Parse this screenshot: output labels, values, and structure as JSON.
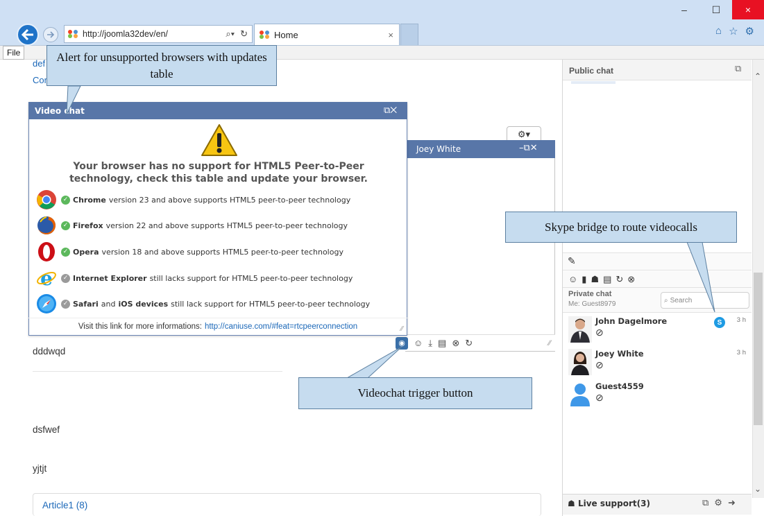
{
  "browser": {
    "url": "http://joomla32dev/en/",
    "tab_title": "Home",
    "menu_file": "File",
    "tab_close": "×",
    "win_min": "–",
    "win_max": "☐",
    "win_close": "×"
  },
  "page": {
    "link_top": "def",
    "link_contact": "Contact",
    "text_1": "dddwqd",
    "text_2": "dsfwef",
    "text_3": "yjtjt",
    "article_link": "Article1 (8)"
  },
  "callouts": {
    "alert": "Alert for unsupported browsers with updates table",
    "skype": "Skype bridge to route videocalls",
    "videochat": "Videochat trigger button"
  },
  "video_chat": {
    "title": "Video chat",
    "heading": "Your browser has no support for HTML5 Peer-to-Peer technology, check this table and update your browser.",
    "browsers": [
      {
        "icon": "chrome-logo-icon",
        "name": "Chrome",
        "text": "version 23 and above supports HTML5 peer-to-peer technology",
        "supported": true
      },
      {
        "icon": "firefox-logo-icon",
        "name": "Firefox",
        "text": "version 22 and above supports HTML5 peer-to-peer technology",
        "supported": true
      },
      {
        "icon": "opera-logo-icon",
        "name": "Opera",
        "text": "version 18 and above supports HTML5 peer-to-peer technology",
        "supported": true
      },
      {
        "icon": "ie-logo-icon",
        "name": "Internet Explorer",
        "text": "still lacks support for HTML5 peer-to-peer technology",
        "supported": false
      },
      {
        "icon": "safari-logo-icon",
        "name": "Safari",
        "mid": "and",
        "name2": "iOS devices",
        "text": "still lack support for HTML5 peer-to-peer technology",
        "supported": false
      }
    ],
    "footer_text": "Visit this link for more informations:",
    "footer_link": "http://caniuse.com/#feat=rtcpeerconnection"
  },
  "joey_window": {
    "title": "Joey White"
  },
  "sidebar": {
    "public_chat_title": "Public chat",
    "private_chat_title": "Private chat",
    "me_label": "Me: Guest8979",
    "search_placeholder": "Search",
    "users": [
      {
        "name": "John Dagelmore",
        "time": "3 h",
        "avatar": "male-avatar"
      },
      {
        "name": "Joey White",
        "time": "3 h",
        "avatar": "female-avatar"
      },
      {
        "name": "Guest4559",
        "time": "",
        "avatar": "guest-avatar"
      }
    ],
    "status_icon": "⊘",
    "live_support": "Live support(3)"
  },
  "colors": {
    "panel_header": "#5876a8",
    "callout_fill": "#c6dcef",
    "link": "#1a67b8",
    "check_green": "#5cb85c",
    "check_gray": "#9a9a9a"
  }
}
